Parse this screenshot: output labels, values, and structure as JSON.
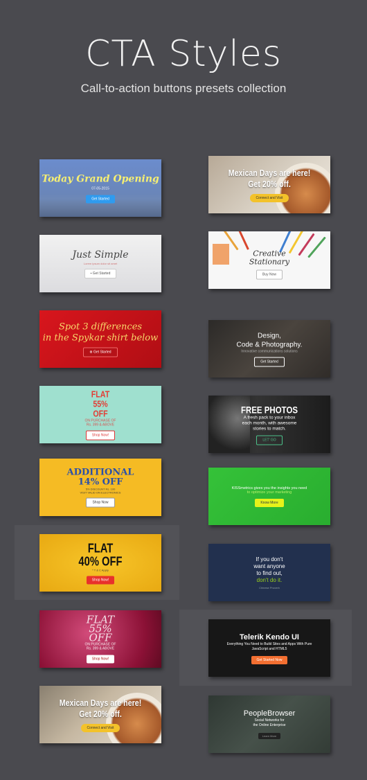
{
  "page": {
    "title": "CTA Styles",
    "subtitle": "Call-to-action buttons presets collection"
  },
  "cards": {
    "c1": {
      "heading": "Today Grand Opening",
      "date": "07-05-2015",
      "button": "Get Started"
    },
    "c2": {
      "heading": "Just Simple",
      "sub": "Lorem ipsum dolor sit amet",
      "button": "Get Started",
      "icon": "comment-icon"
    },
    "c3": {
      "line1": "Spot 3 differences",
      "line2": "in the Spykar shirt below",
      "button": "Get Started",
      "icon": "plus-circle-icon"
    },
    "c4": {
      "line1": "FLAT",
      "line2": "55%",
      "line3": "OFF",
      "sub1": "ON PURCHASE OF",
      "sub2": "Rs. 399 & ABOVE",
      "button": "Shop Now!"
    },
    "c5": {
      "line1": "ADDITIONAL",
      "line2": "14% OFF",
      "sub1": "5% DISCOUNT Rs. 100",
      "sub2": "VISIT VALID ON ELECTRONICS",
      "button": "Shop Now"
    },
    "c6": {
      "line1": "FLAT",
      "line2": "40% OFF",
      "sub": "* T & C Apply",
      "button": "Shop Now!"
    },
    "c7": {
      "line1": "FLAT",
      "line2": "55%",
      "line3": "OFF",
      "sub1": "ON PURCHASE OF",
      "sub2": "Rs. 399 & ABOVE",
      "button": "Shop Now!"
    },
    "c8": {
      "line1": "Mexican Days are here!",
      "line2": "Get 20% off.",
      "button": "Connect and Visit"
    },
    "d1": {
      "line1": "Mexican Days are here!",
      "line2": "Get 20% off.",
      "button": "Connect and Visit"
    },
    "d2": {
      "line1": "Creative",
      "line2": "Stationary",
      "button": "Buy Now"
    },
    "d3": {
      "line1": "Design,",
      "line2": "Code & Photography.",
      "sub": "Innovative communications solutions",
      "button": "Get Started"
    },
    "d4": {
      "heading": "FREE PHOTOS",
      "body1": "A fresh pack to your inbox",
      "body2": "each month, with awesome",
      "body3": "stories to match.",
      "button": "LET' GO"
    },
    "d5": {
      "body1": "KISSmetrics gives you the insights you need",
      "body2": "to optimize your marketing",
      "button": "Know More"
    },
    "d6": {
      "line1": "If you don't",
      "line2": "want anyone",
      "line3": "to find out,",
      "line4": "don't do it.",
      "author": "Chinese Proverb"
    },
    "d7": {
      "heading": "Telerik Kendo UI",
      "body1": "Everything You Need to Build Sites and Apps With Pure",
      "body2": "JavaScript and HTML5",
      "button": "Get Started Now"
    },
    "d8": {
      "heading": "PeopleBrowser",
      "body1": "Social Networks for",
      "body2": "the Online Enterprise",
      "button": "Learn More"
    }
  },
  "colors": {
    "background": "#4a4a4f",
    "accent_blue": "#2f9bef",
    "accent_red": "#e8312b",
    "accent_green": "#9bd21a",
    "accent_orange": "#f36f31"
  }
}
